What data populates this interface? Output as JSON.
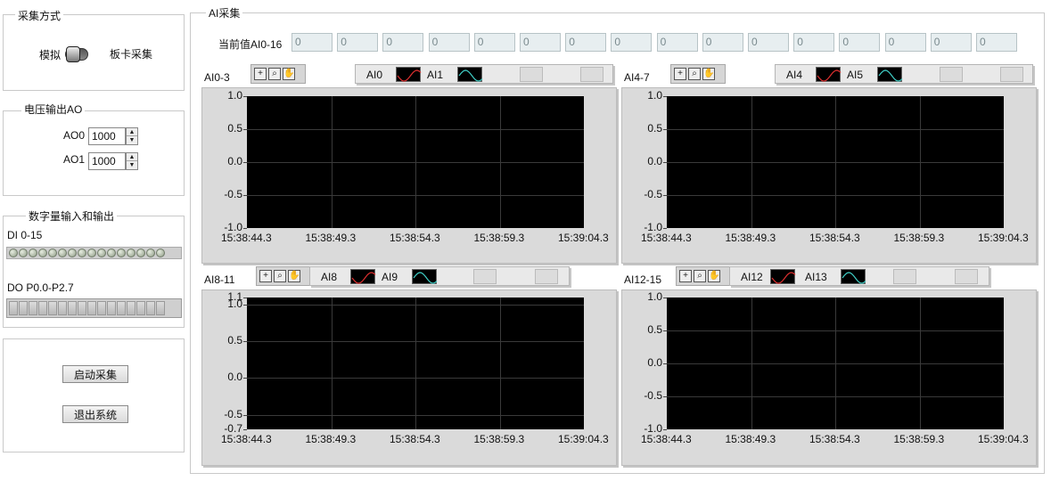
{
  "acq_mode": {
    "title": "采集方式",
    "left_label": "模拟",
    "right_label": "板卡采集"
  },
  "ao": {
    "title": "电压输出AO",
    "rows": [
      {
        "label": "AO0",
        "value": "1000"
      },
      {
        "label": "AO1",
        "value": "1000"
      }
    ]
  },
  "dio": {
    "title": "数字量输入和输出",
    "di_label": "DI 0-15",
    "do_label": "DO P0.0-P2.7"
  },
  "buttons": {
    "start": "启动采集",
    "exit": "退出系统"
  },
  "ai": {
    "title": "AI采集",
    "current_label": "当前值AI0-16",
    "current_values": [
      "0",
      "0",
      "0",
      "0",
      "0",
      "0",
      "0",
      "0",
      "0",
      "0",
      "0",
      "0",
      "0",
      "0",
      "0",
      "0"
    ]
  },
  "charts": [
    {
      "label": "AI0-3",
      "legend": [
        "AI0",
        "AI1"
      ],
      "yticks": [
        "1.0",
        "0.5",
        "0.0",
        "-0.5",
        "-1.0"
      ],
      "xticks": [
        "15:38:44.3",
        "15:38:49.3",
        "15:38:54.3",
        "15:38:59.3",
        "15:39:04.3"
      ]
    },
    {
      "label": "AI4-7",
      "legend": [
        "AI4",
        "AI5"
      ],
      "yticks": [
        "1.0",
        "0.5",
        "0.0",
        "-0.5",
        "-1.0"
      ],
      "xticks": [
        "15:38:44.3",
        "15:38:49.3",
        "15:38:54.3",
        "15:38:59.3",
        "15:39:04.3"
      ]
    },
    {
      "label": "AI8-11",
      "legend": [
        "AI8",
        "AI9"
      ],
      "yticks": [
        "1.1",
        "1.0",
        "0.5",
        "0.0",
        "-0.5",
        "-0.7"
      ],
      "xticks": [
        "15:38:44.3",
        "15:38:49.3",
        "15:38:54.3",
        "15:38:59.3",
        "15:39:04.3"
      ]
    },
    {
      "label": "AI12-15",
      "legend": [
        "AI12",
        "AI13"
      ],
      "yticks": [
        "1.0",
        "0.5",
        "0.0",
        "-0.5",
        "-1.0"
      ],
      "xticks": [
        "15:38:44.3",
        "15:38:49.3",
        "15:38:54.3",
        "15:38:59.3",
        "15:39:04.3"
      ]
    }
  ],
  "colors": {
    "series_a": "#e03030",
    "series_b": "#40d0c8",
    "plot_bg": "#000000"
  },
  "icons": [
    "crosshair-icon",
    "zoom-icon",
    "pan-hand-icon"
  ]
}
